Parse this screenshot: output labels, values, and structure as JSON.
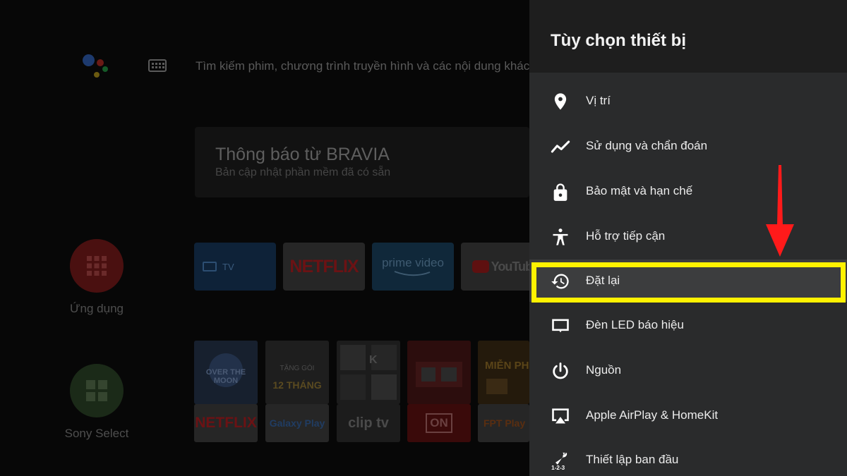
{
  "home": {
    "search_placeholder": "Tìm kiếm phim, chương trình truyền hình và các nội dung khác",
    "notification": {
      "title": "Thông báo từ BRAVIA",
      "subtitle": "Bản cập nhật phần mềm đã có sẵn"
    },
    "sidebar": [
      {
        "label": "Ứng dụng",
        "icon": "apps-grid-icon",
        "color": "#4a1010"
      },
      {
        "label": "Sony Select",
        "icon": "sony-select-icon",
        "color": "#1b2a18"
      }
    ],
    "apps": [
      {
        "label": "TV",
        "icon": "tv-icon",
        "color": "#0e2238"
      },
      {
        "label": "NETFLIX",
        "color": "#262626"
      },
      {
        "label": "prime video",
        "color": "#10283a"
      },
      {
        "label": "YouTube",
        "color": "#262626"
      }
    ],
    "content_row": [
      {
        "label": "NETFLIX",
        "thumb_text": "OVER THE MOON"
      },
      {
        "label": "Galaxy Play",
        "thumb_text": "TẶNG GÓI 12 THÁNG"
      },
      {
        "label": "clip tv",
        "thumb_text": "K"
      },
      {
        "label": "ON",
        "thumb_text": ""
      },
      {
        "label": "FPT Play",
        "thumb_text": "MIỄN PHÍ"
      }
    ]
  },
  "panel": {
    "title": "Tùy chọn thiết bị",
    "items": [
      {
        "label": "Vị trí",
        "icon": "location-pin-icon"
      },
      {
        "label": "Sử dụng và chẩn đoán",
        "icon": "usage-graph-icon"
      },
      {
        "label": "Bảo mật và hạn chế",
        "icon": "lock-icon"
      },
      {
        "label": "Hỗ trợ tiếp cận",
        "icon": "accessibility-icon"
      },
      {
        "label": "Đặt lại",
        "icon": "reset-history-icon"
      },
      {
        "label": "Đèn LED báo hiệu",
        "icon": "led-indicator-icon"
      },
      {
        "label": "Nguồn",
        "icon": "power-icon"
      },
      {
        "label": "Apple AirPlay & HomeKit",
        "icon": "airplay-icon"
      },
      {
        "label": "Thiết lập ban đầu",
        "icon": "initial-setup-icon"
      }
    ]
  },
  "annotation": {
    "highlight_color": "#fff200",
    "arrow_color": "#ff1a1a"
  }
}
